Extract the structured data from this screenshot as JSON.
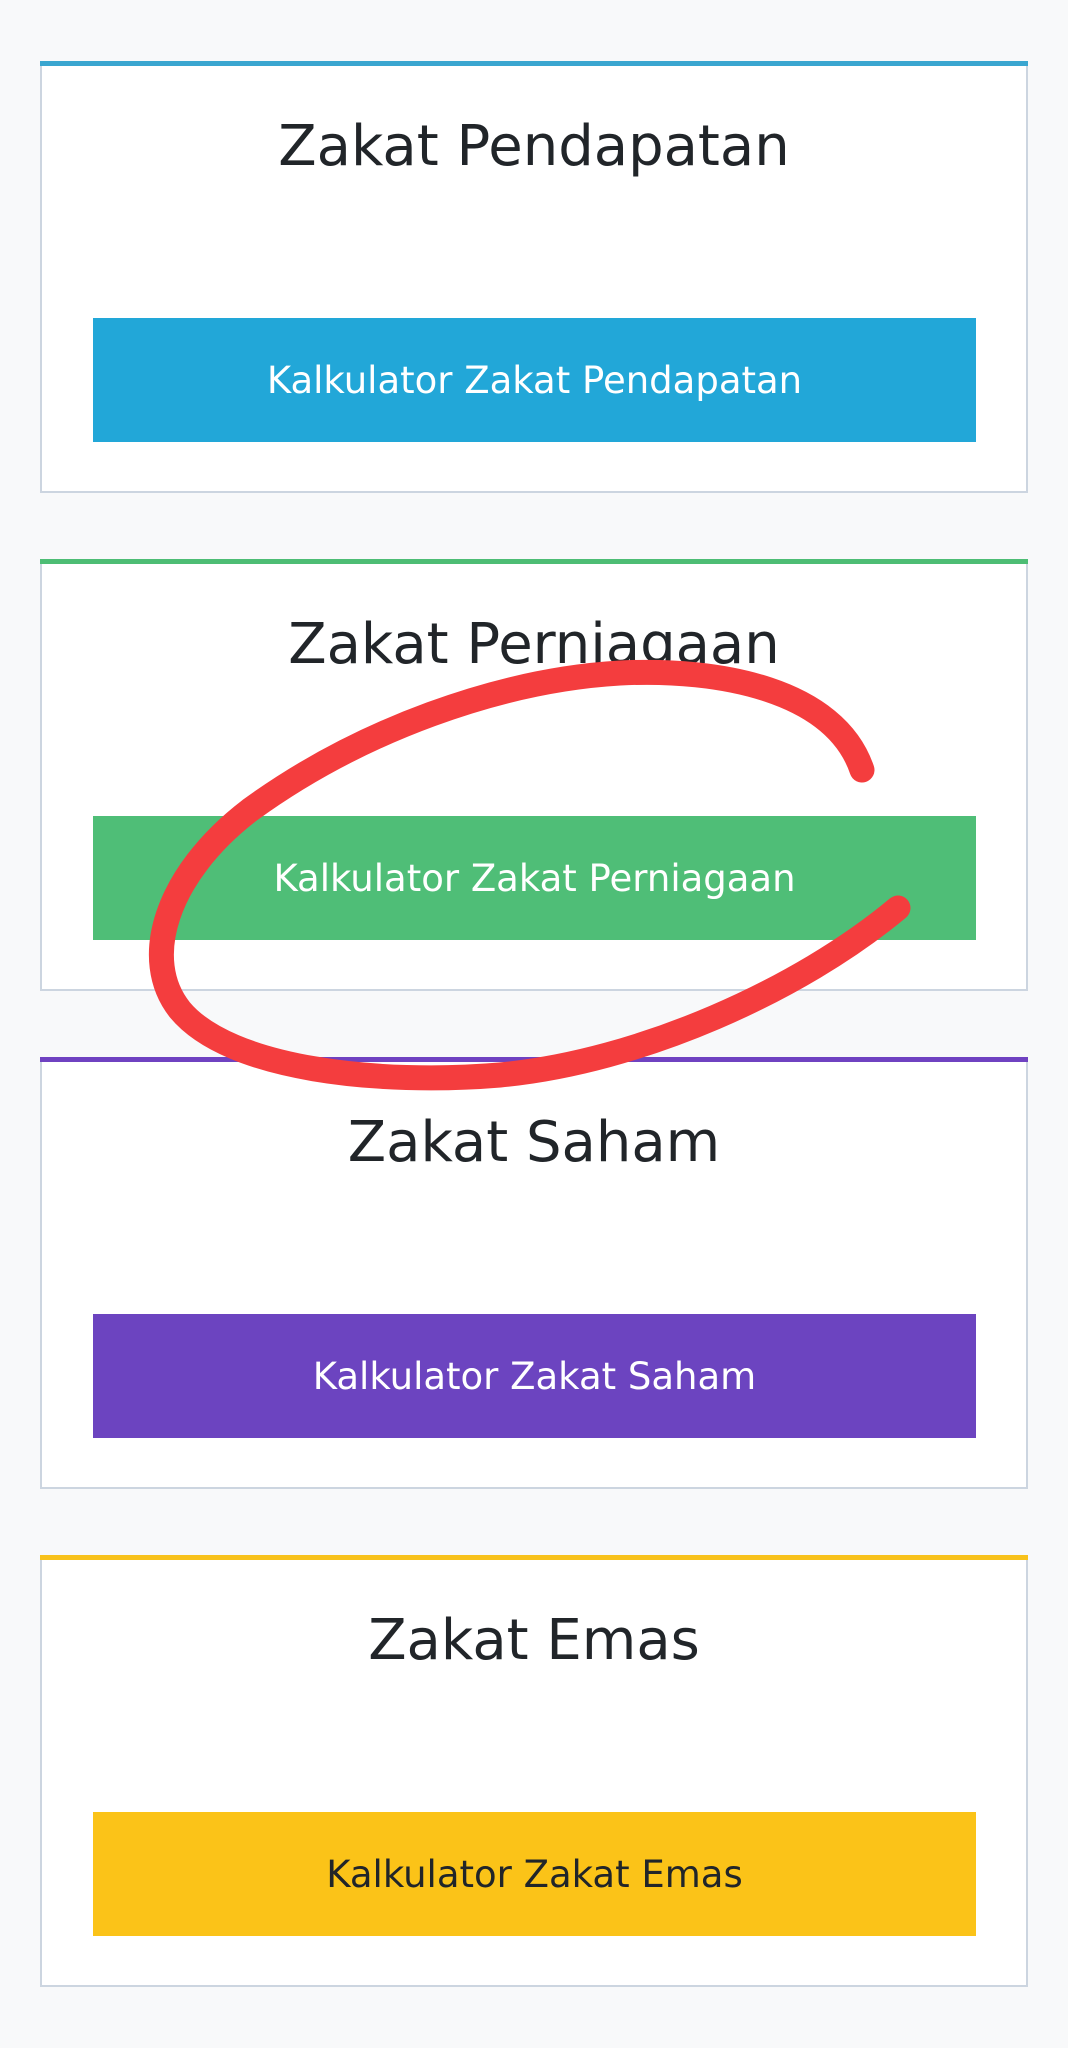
{
  "cards": [
    {
      "title": "Zakat Pendapatan",
      "button_label": "Kalkulator Zakat Pendapatan",
      "accent_color": "#3aa6d0",
      "button_color": "#22a7d8",
      "button_text_color": "#ffffff"
    },
    {
      "title": "Zakat Perniagaan",
      "button_label": "Kalkulator Zakat Perniagaan",
      "accent_color": "#4dbd74",
      "button_color": "#4fbe77",
      "button_text_color": "#ffffff"
    },
    {
      "title": "Zakat Saham",
      "button_label": "Kalkulator Zakat Saham",
      "accent_color": "#6f42c1",
      "button_color": "#6c44c0",
      "button_text_color": "#ffffff"
    },
    {
      "title": "Zakat Emas",
      "button_label": "Kalkulator Zakat Emas",
      "accent_color": "#f8c21b",
      "button_color": "#fbc318",
      "button_text_color": "#212529"
    }
  ],
  "annotation": {
    "stroke_color": "#f43d3e"
  }
}
